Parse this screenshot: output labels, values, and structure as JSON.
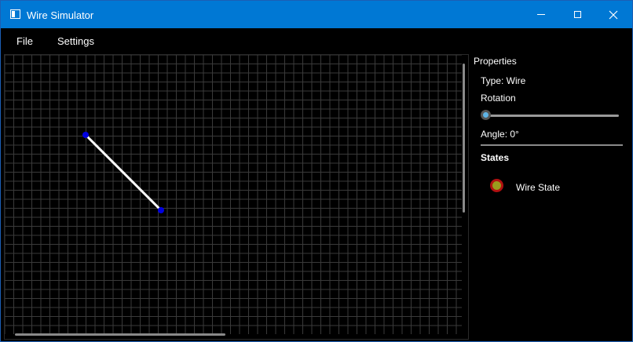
{
  "window": {
    "title": "Wire Simulator",
    "controls": {
      "minimize": "minimize",
      "maximize": "maximize",
      "close": "close"
    }
  },
  "menu": {
    "items": [
      "File",
      "Settings"
    ]
  },
  "properties": {
    "title": "Properties",
    "type_label": "Type: Wire",
    "rotation_label": "Rotation",
    "rotation_value_deg": 0,
    "angle_label": "Angle: 0°",
    "states_title": "States",
    "states": [
      {
        "label": "Wire State",
        "fill_color": "#9a9a1e",
        "ring_color": "#b01010"
      }
    ]
  },
  "canvas": {
    "background": "#000000",
    "grid_color": "#3a3a3a",
    "wire_color": "#ffffff",
    "endpoint_color": "#0000e0"
  },
  "icons": {
    "app": "app-window-icon",
    "close": "close-icon",
    "minimize": "minimize-icon",
    "maximize": "maximize-icon"
  }
}
